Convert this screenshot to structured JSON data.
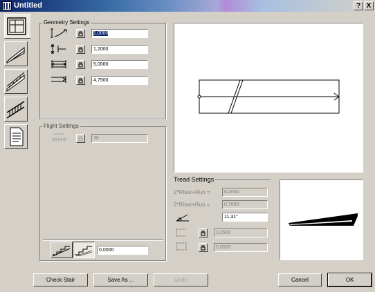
{
  "window": {
    "title": "Untitled",
    "help_label": "?",
    "close_label": "X"
  },
  "tabs": [
    {
      "name": "geometry",
      "icon": "stair-geometry-icon"
    },
    {
      "name": "structure",
      "icon": "stair-structure-icon"
    },
    {
      "name": "treads",
      "icon": "stair-treads-icon"
    },
    {
      "name": "railing",
      "icon": "stair-railing-icon"
    },
    {
      "name": "listing",
      "icon": "document-icon"
    }
  ],
  "geometry": {
    "title": "Geometry Settings",
    "rows": [
      {
        "icon": "height-icon",
        "value": "1,0000"
      },
      {
        "icon": "riser-count-icon",
        "value": "1,2000"
      },
      {
        "icon": "width-icon",
        "value": "5,0000"
      },
      {
        "icon": "length-icon",
        "value": "4,7500"
      }
    ]
  },
  "flight": {
    "title": "Flight Settings",
    "value": "30"
  },
  "bottom_field": {
    "value": "0,0000"
  },
  "tread": {
    "title": "Tread Settings",
    "riser_run_1": {
      "label": "2*Riser+Run =",
      "value": "0,2000"
    },
    "riser_run_2": {
      "label": "2*Riser+Run =",
      "value": "0,7000"
    },
    "angle": {
      "value": "11,31°"
    },
    "tread_field": {
      "value": "0,2500"
    },
    "riser_field": {
      "value": "0,0500"
    }
  },
  "buttons": {
    "check_stair": "Check Stair",
    "save_as": "Save As ...",
    "undo": "Undo",
    "cancel": "Cancel",
    "ok": "OK"
  }
}
